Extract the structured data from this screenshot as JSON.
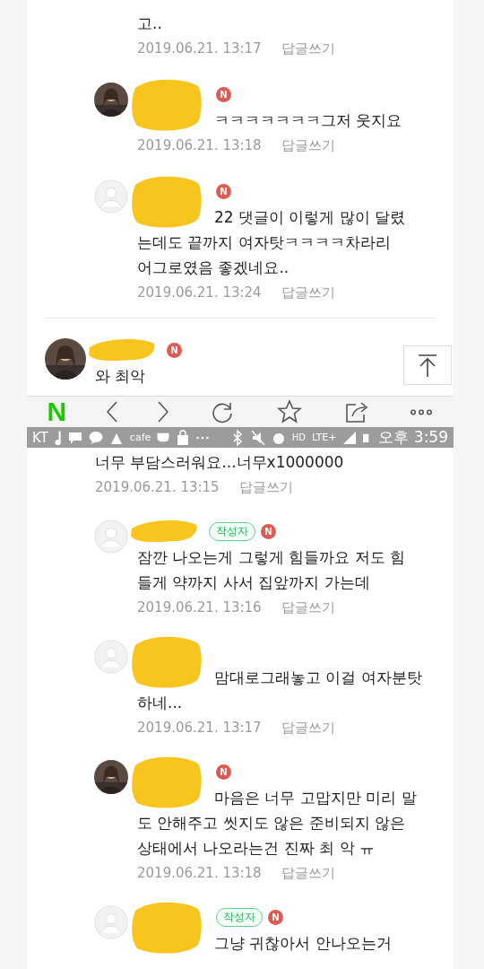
{
  "top_thread": {
    "comments": [
      {
        "reply": true,
        "kind": "no_avatar",
        "name_redacted": false,
        "text_redacted": false,
        "text": "고..",
        "date": "2019.06.21. 13:17",
        "reply_link": "답글쓰기"
      },
      {
        "reply": true,
        "name_redacted": true,
        "text_redacted": true,
        "new_badge": "N",
        "text": "ㅋㅋㅋㅋㅋㅋㅋ그저 웃지요",
        "date": "2019.06.21. 13:18",
        "reply_link": "답글쓰기"
      },
      {
        "reply": true,
        "kind": "default",
        "name_redacted": true,
        "text_redacted": true,
        "new_badge": "N",
        "text": "22 댓글이 이렇게 많이 달렸\n는데도 끝까지 여자탓ㅋㅋㅋㅋ차라리\n어그로였음 좋겠네요..",
        "date": "2019.06.21. 13:24",
        "reply_link": "답글쓰기"
      }
    ]
  },
  "comment": {
    "reply": false,
    "name_redacted": true,
    "text_redacted": false,
    "new_badge": "N",
    "text": "와 최악"
  },
  "scroll_top_button": true,
  "toolbar": {
    "logo": "N",
    "buttons": [
      {
        "kind": "back"
      },
      {
        "kind": "forward"
      },
      {
        "kind": "reload"
      },
      {
        "kind": "bookmark"
      },
      {
        "kind": "share"
      },
      {
        "kind": "more"
      }
    ]
  },
  "status_bar": {
    "carrier": "KT",
    "cafe": "cafe",
    "hd": "HD",
    "network": "LTE+",
    "time": "오후 3:59"
  },
  "bottom_thread": {
    "comments": [
      {
        "reply": false,
        "kind": "no_avatar",
        "name_redacted": false,
        "text_redacted": false,
        "text": "너무 부담스러워요...너무x1000000",
        "date": "2019.06.21. 13:15",
        "reply_link": "답글쓰기"
      },
      {
        "reply": true,
        "kind": "default",
        "name_redacted": true,
        "text_redacted": false,
        "author_badge": "작성자",
        "new_badge": "N",
        "text": "잠깐 나오는게 그렇게 힘들까요 저도 힘\n들게 약까지 사서 집앞까지 가는데",
        "date": "2019.06.21. 13:16",
        "reply_link": "답글쓰기"
      },
      {
        "reply": true,
        "kind": "default",
        "name_redacted": true,
        "text_redacted": true,
        "text": "맘대로그래놓고 이걸 여자분탓\n하네...",
        "date": "2019.06.21. 13:17",
        "reply_link": "답글쓰기"
      },
      {
        "reply": true,
        "name_redacted": true,
        "text_redacted": true,
        "new_badge": "N",
        "text": "마음은 너무 고맙지만 미리 말\n도 안해주고 씻지도 않은 준비되지 않은\n상태에서 나오라는건 진짜 최 악 ㅠ",
        "date": "2019.06.21. 13:18",
        "reply_link": "답글쓰기"
      },
      {
        "reply": true,
        "kind": "default",
        "name_redacted": true,
        "text_redacted": true,
        "author_badge": "작성자",
        "new_badge": "N",
        "text": "그냥 귀찮아서 안나오는거"
      }
    ]
  }
}
